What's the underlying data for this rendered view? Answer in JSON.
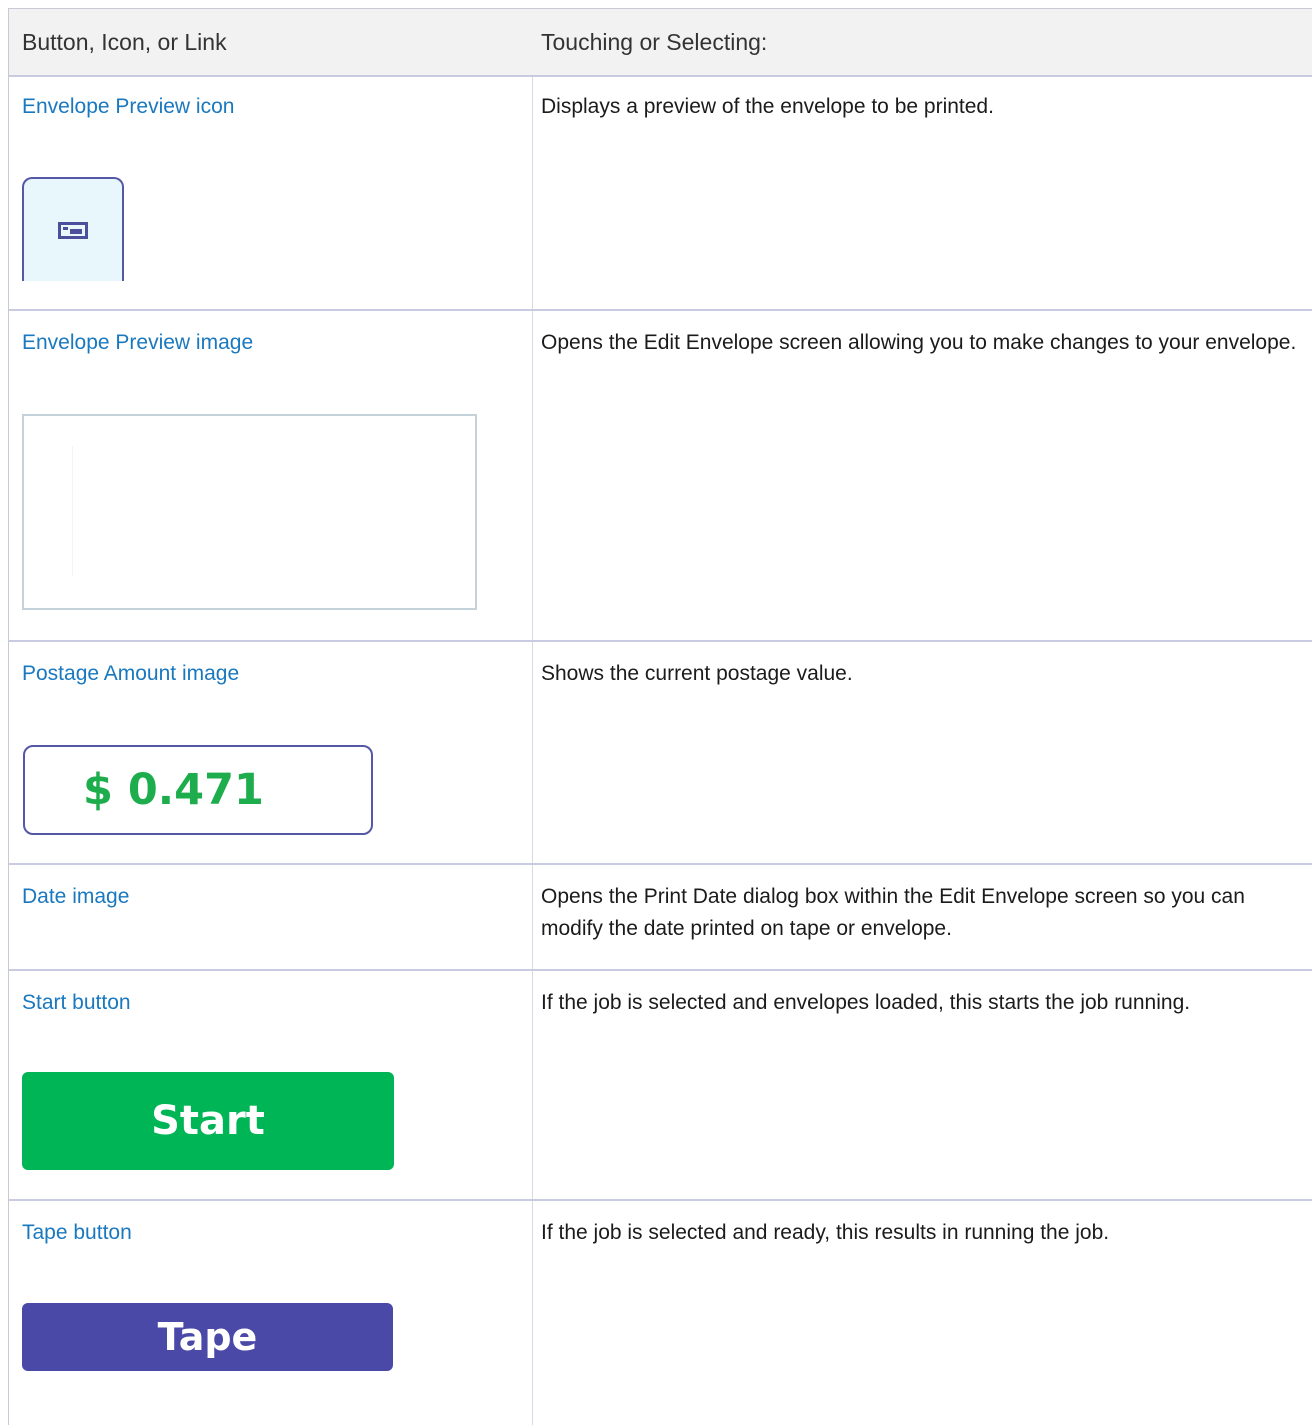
{
  "table": {
    "col1_header": "Button, Icon, or Link",
    "col2_header": "Touching or Selecting:",
    "rows": [
      {
        "term": "Envelope Preview icon",
        "description": "Displays a preview of the envelope to be printed.",
        "graphic": "envelope-preview-icon"
      },
      {
        "term": "Envelope Preview image",
        "description": "Opens the Edit Envelope screen allowing you to make changes to your envelope.",
        "graphic": "envelope-preview-image"
      },
      {
        "term": "Postage Amount image",
        "description": "Shows the current postage value.",
        "graphic_text": "$ 0.471",
        "graphic_color": "#1dad4c"
      },
      {
        "term": "Date image",
        "description": "Opens the Print Date dialog box within the Edit Envelope screen so you can modify the date printed on tape or envelope."
      },
      {
        "term": "Start button",
        "description": "If the job is selected and envelopes loaded, this starts the job running.",
        "graphic_text": "Start",
        "graphic_color": "#00b556"
      },
      {
        "term": "Tape button",
        "description": "If the job is selected and ready, this results in running the job.",
        "graphic_text": "Tape",
        "graphic_color": "#4a49a8"
      }
    ]
  },
  "colors": {
    "link": "#1a78bf",
    "header_bg": "#f2f2f2",
    "border": "#c9cbe0"
  }
}
